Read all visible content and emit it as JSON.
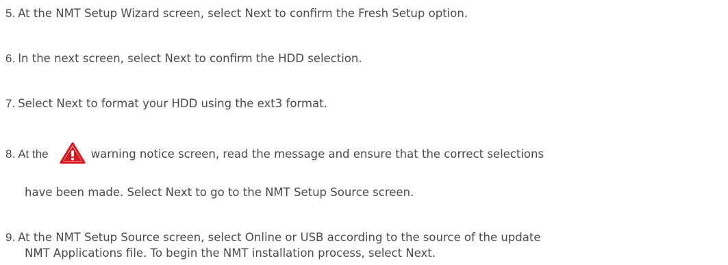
{
  "steps": [
    {
      "number": "5.",
      "text": "At the NMT Setup Wizard screen, select Next to confirm the Fresh Setup option."
    },
    {
      "number": "6.",
      "text": "In the next screen, select Next to confirm the HDD selection."
    },
    {
      "number": "7.",
      "text": "Select Next to format your HDD using the ext3 format."
    },
    {
      "number": "8.",
      "text_before_icon": "At the",
      "icon": "warning-icon",
      "text_after_icon": "warning notice screen, read the message and ensure that the correct selections",
      "continuation": "have been made. Select Next to go to the NMT Setup Source screen."
    },
    {
      "number": "9.",
      "text": "At the NMT Setup Source screen, select Online or USB according to the source of the update",
      "continuation": "NMT Applications file. To begin the NMT installation process, select Next."
    }
  ],
  "colors": {
    "text": "#4a4a4a",
    "warning_red": "#d6181e"
  }
}
